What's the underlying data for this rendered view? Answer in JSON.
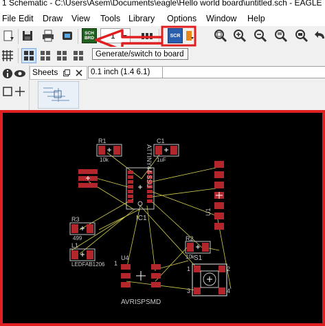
{
  "window": {
    "title": "1 Schematic - C:\\Users\\Asem\\Documents\\eagle\\Hello world board\\untitled.sch - EAGLE"
  },
  "menu": {
    "items": [
      "File",
      "Edit",
      "Draw",
      "View",
      "Tools",
      "Library",
      "Options",
      "Window",
      "Help"
    ]
  },
  "tooltip": {
    "text": "Generate/switch to board"
  },
  "toolbar": {
    "grid_label": "1",
    "scr_label": "SCR",
    "brd_label_top": "SCH",
    "brd_label_bottom": "BRD"
  },
  "sheets_panel": {
    "title": "Sheets"
  },
  "command": {
    "coordinates": "0.1 inch (1.4 6.1)",
    "command_value": ""
  },
  "board": {
    "components": [
      {
        "id": "r1",
        "name": "R1",
        "value": "10k"
      },
      {
        "id": "c1",
        "name": "C1",
        "value": "1uF"
      },
      {
        "id": "ic1",
        "name": "IC1",
        "value": "ATTINY44-SSU"
      },
      {
        "id": "u1",
        "name": "U1",
        "value": ""
      },
      {
        "id": "r3",
        "name": "R3",
        "value": "499"
      },
      {
        "id": "l1",
        "name": "L1",
        "value": "LEDFAB1206"
      },
      {
        "id": "r2",
        "name": "R2",
        "value": "10k"
      },
      {
        "id": "u4",
        "name": "U4",
        "value": "AVRISPSMD"
      },
      {
        "id": "s1",
        "name": "S1",
        "value": ""
      }
    ],
    "pin_labels": {
      "u4_pin1": "1",
      "s1_pin1": "1",
      "s1_pin2": "2",
      "s1_pin3": "3",
      "s1_pin4": "4"
    }
  },
  "colors": {
    "highlight": "#e02020",
    "pad": "#b3262b",
    "airwire": "#d6cf4f",
    "outline": "#c7c7c7",
    "canvas": "#000000"
  }
}
